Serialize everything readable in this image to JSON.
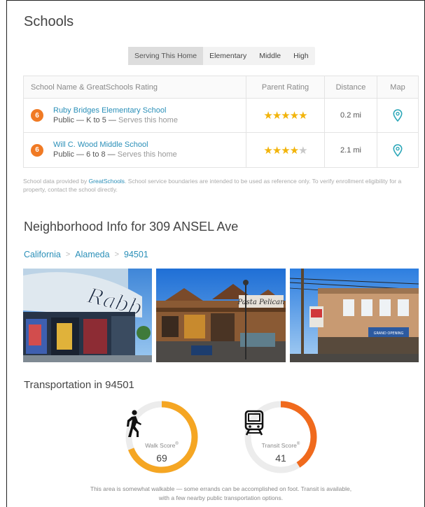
{
  "schools": {
    "title": "Schools",
    "tabs": [
      "Serving This Home",
      "Elementary",
      "Middle",
      "High"
    ],
    "columns": [
      "School Name & GreatSchools Rating",
      "Parent Rating",
      "Distance",
      "Map"
    ],
    "rows": [
      {
        "rating": "6",
        "name": "Ruby Bridges Elementary School",
        "type": "Public",
        "grades": "K to 5",
        "serves": "Serves this home",
        "stars": 5,
        "distance": "0.2 mi"
      },
      {
        "rating": "6",
        "name": "Will C. Wood Middle School",
        "type": "Public",
        "grades": "6 to 8",
        "serves": "Serves this home",
        "stars": 4,
        "distance": "2.1 mi"
      }
    ],
    "note_prefix": "School data provided by ",
    "note_link": "GreatSchools",
    "note_suffix": ". School service boundaries are intended to be used as reference only. To verify enrollment eligibility for a property, contact the school directly."
  },
  "neighborhood": {
    "title": "Neighborhood Info for 309 ANSEL Ave",
    "breadcrumb": [
      "California",
      "Alameda",
      "94501"
    ]
  },
  "transportation": {
    "title": "Transportation in 94501",
    "walk": {
      "label": "Walk Score",
      "reg": "®",
      "value": "69",
      "score": 69,
      "icon": "pedestrian-icon",
      "color": "#f5a623"
    },
    "transit": {
      "label": "Transit Score",
      "reg": "®",
      "value": "41",
      "score": 41,
      "icon": "train-icon",
      "color": "#f06a1d"
    },
    "summary_line1": "This area is somewhat walkable — some errands can be accomplished on foot. Transit is available,",
    "summary_line2": "with a few nearby public transportation options."
  }
}
